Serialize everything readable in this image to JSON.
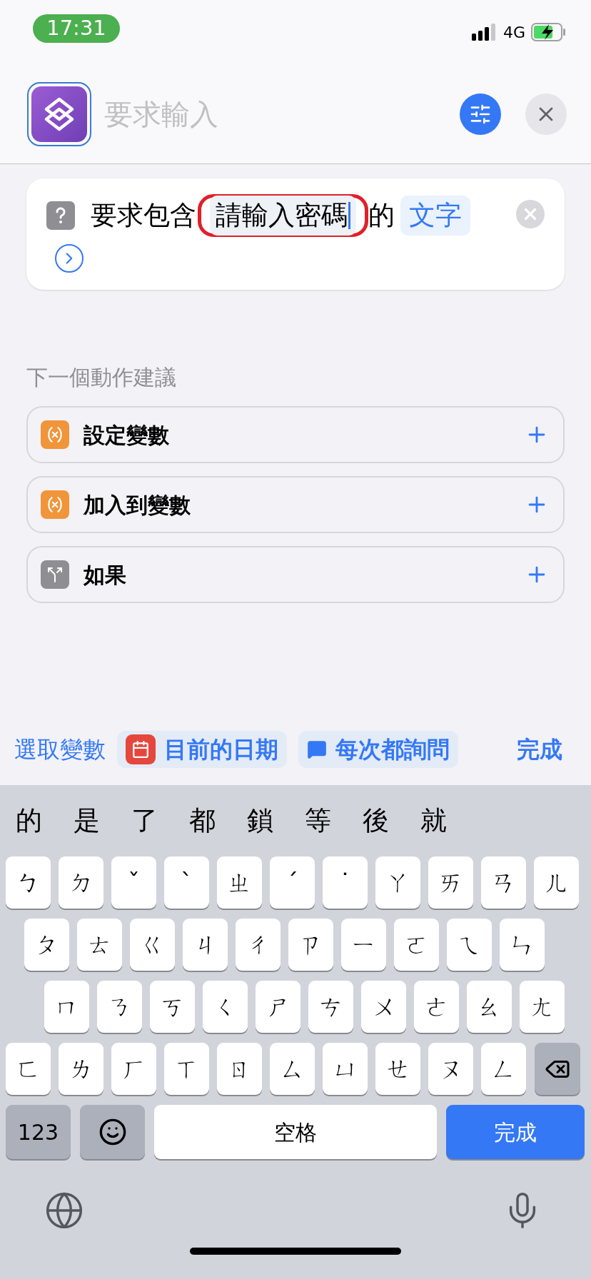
{
  "status_bar": {
    "time": "17:31",
    "network": "4G"
  },
  "header": {
    "title": "要求輸入"
  },
  "action": {
    "prefix": "要求包含",
    "field": {
      "value": "請輸入密碼",
      "highlighted": true
    },
    "suffix": "的",
    "type_token": "文字"
  },
  "suggestions": {
    "heading": "下一個動作建議",
    "items": [
      {
        "label": "設定變數",
        "kind": "variable"
      },
      {
        "label": "加入到變數",
        "kind": "variable"
      },
      {
        "label": "如果",
        "kind": "condition"
      }
    ]
  },
  "toolbar": {
    "pick_variable": "選取變數",
    "chips": [
      {
        "label": "目前的日期",
        "kind": "date"
      },
      {
        "label": "每次都詢問",
        "kind": "ask"
      }
    ],
    "done": "完成"
  },
  "keyboard": {
    "candidates": [
      "的",
      "是",
      "了",
      "都",
      "鎖",
      "等",
      "後",
      "就"
    ],
    "rows": [
      [
        "ㄅ",
        "ㄉ",
        "ˇ",
        "ˋ",
        "ㄓ",
        "ˊ",
        "˙",
        "ㄚ",
        "ㄞ",
        "ㄢ",
        "ㄦ"
      ],
      [
        "ㄆ",
        "ㄊ",
        "ㄍ",
        "ㄐ",
        "ㄔ",
        "ㄗ",
        "ㄧ",
        "ㄛ",
        "ㄟ",
        "ㄣ"
      ],
      [
        "ㄇ",
        "ㄋ",
        "ㄎ",
        "ㄑ",
        "ㄕ",
        "ㄘ",
        "ㄨ",
        "ㄜ",
        "ㄠ",
        "ㄤ"
      ],
      [
        "ㄈ",
        "ㄌ",
        "ㄏ",
        "ㄒ",
        "ㄖ",
        "ㄙ",
        "ㄩ",
        "ㄝ",
        "ㄡ",
        "ㄥ"
      ]
    ],
    "numbers_key": "123",
    "space_key": "空格",
    "return_key": "完成"
  }
}
